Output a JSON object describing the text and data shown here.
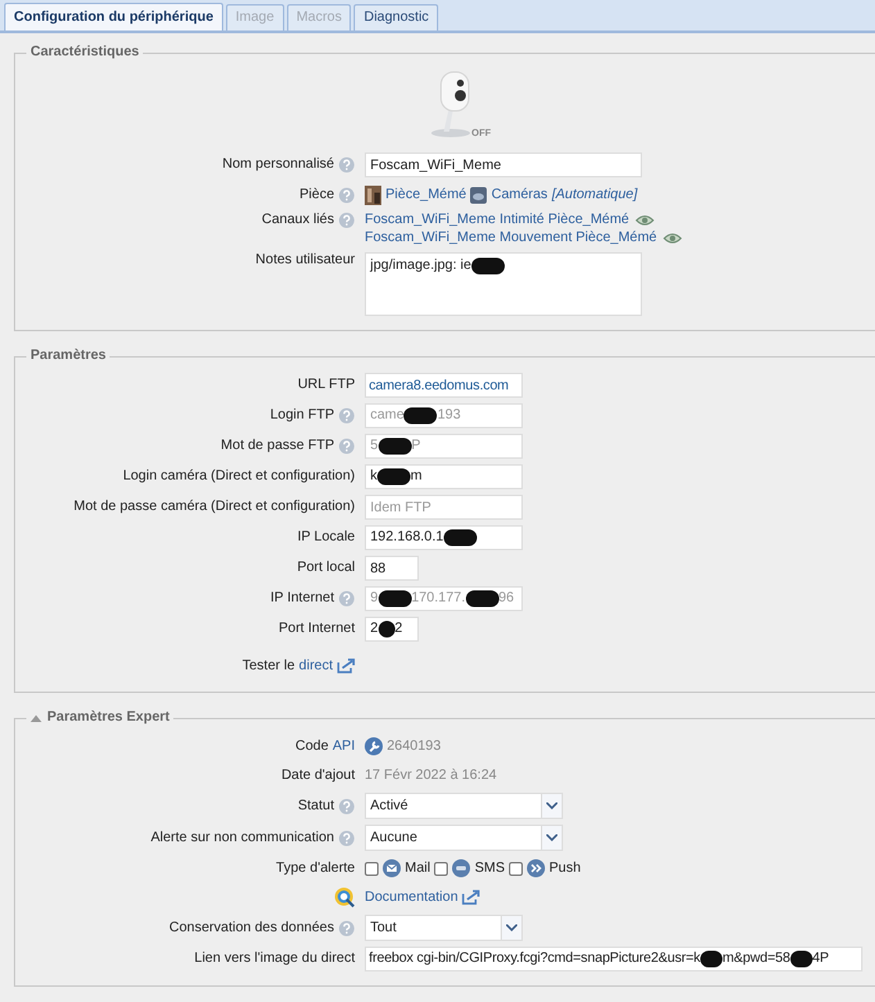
{
  "tabs": [
    {
      "label": "Configuration du périphérique",
      "selected": true,
      "disabled": false
    },
    {
      "label": "Image",
      "selected": false,
      "disabled": true
    },
    {
      "label": "Macros",
      "selected": false,
      "disabled": true
    },
    {
      "label": "Diagnostic",
      "selected": false,
      "disabled": false
    }
  ],
  "sections": [
    {
      "title": "Caractéristiques",
      "camera": {
        "status": "OFF"
      },
      "rows": [
        {
          "kind": "input",
          "label": "Nom personnalisé",
          "help": true,
          "value": "Foscam_WiFi_Meme"
        },
        {
          "kind": "links",
          "label": "Pièce",
          "help": true,
          "items": [
            {
              "text": "Pièce_Mémé"
            },
            {
              "text": "Caméras"
            },
            {
              "text": "[Automatique]",
              "italic": true
            }
          ]
        },
        {
          "kind": "channels",
          "label": "Canaux liés",
          "help": true,
          "items": [
            "Foscam_WiFi_Meme Intimité Pièce_Mémé",
            "Foscam_WiFi_Meme Mouvement Pièce_Mémé"
          ]
        },
        {
          "kind": "textarea",
          "label": "Notes utilisateur",
          "value_parts": [
            "jpg/image.jpg: ie"
          ],
          "redacted_end": true
        }
      ]
    },
    {
      "title": "Paramètres",
      "rows": [
        {
          "kind": "input",
          "label": "URL FTP",
          "value": "camera8.eedomus.com",
          "link": true
        },
        {
          "kind": "input",
          "label": "Login FTP",
          "help": true,
          "value_parts": [
            "came",
            "193"
          ],
          "disabled": true
        },
        {
          "kind": "input",
          "label": "Mot de passe FTP",
          "help": true,
          "value_parts": [
            "5",
            "P"
          ],
          "disabled": true
        },
        {
          "kind": "input",
          "label": "Login caméra (Direct et configuration)",
          "value_parts": [
            "k",
            "m"
          ]
        },
        {
          "kind": "input",
          "label": "Mot de passe caméra (Direct et configuration)",
          "placeholder": "Idem FTP"
        },
        {
          "kind": "input",
          "label": "IP Locale",
          "value_parts": [
            "192.168.0.1"
          ],
          "redacted_end": true
        },
        {
          "kind": "input",
          "label": "Port local",
          "value": "88"
        },
        {
          "kind": "input",
          "label": "IP Internet",
          "help": true,
          "value_parts": [
            "9",
            "170.177.",
            "96"
          ],
          "disabled": true
        },
        {
          "kind": "input",
          "label": "Port Internet",
          "value_parts": [
            "2",
            "2"
          ]
        },
        {
          "kind": "labellink",
          "label": "Tester le",
          "link": "direct"
        }
      ]
    },
    {
      "title": "Paramètres Expert",
      "expanded": true,
      "rows": [
        {
          "kind": "value",
          "label": "Code",
          "label_link": "API",
          "value": "2640193"
        },
        {
          "kind": "value",
          "label": "Date d'ajout",
          "value": "17 Févr 2022 à 16:24"
        },
        {
          "kind": "select",
          "label": "Statut",
          "help": true,
          "value": "Activé"
        },
        {
          "kind": "select",
          "label": "Alerte sur non communication",
          "help": true,
          "value": "Aucune"
        },
        {
          "kind": "checks",
          "label": "Type d'alerte",
          "options": [
            {
              "label": "Mail",
              "checked": false
            },
            {
              "label": "SMS",
              "checked": false
            },
            {
              "label": "Push",
              "checked": false
            }
          ]
        },
        {
          "kind": "doc",
          "link": "Documentation"
        },
        {
          "kind": "select",
          "label": "Conservation des données",
          "help": true,
          "value": "Tout"
        },
        {
          "kind": "input",
          "label": "Lien vers l'image du direct",
          "value_parts": [
            "freebox cgi-bin/CGIProxy.fcgi?cmd=snapPicture2&usr=k",
            "m&pwd=58",
            "4P"
          ]
        }
      ]
    }
  ]
}
